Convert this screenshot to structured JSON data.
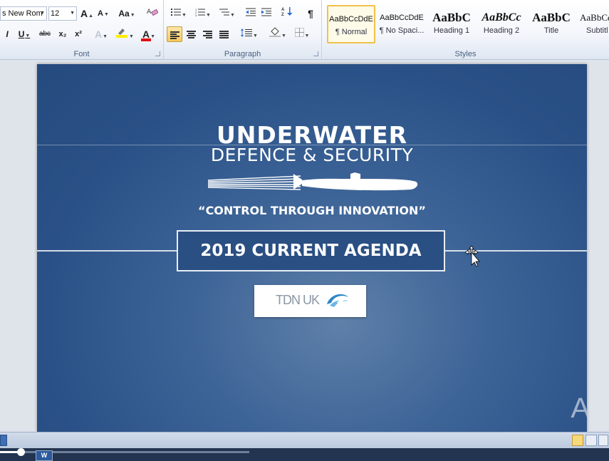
{
  "ribbon": {
    "font_group": {
      "label": "Font",
      "font_name": "s New Rom",
      "font_size": "12",
      "grow_font": "A",
      "shrink_font": "A",
      "change_case": "Aa",
      "italic": "I",
      "underline": "U",
      "strikethrough": "abc",
      "subscript": "x₂",
      "superscript": "x²",
      "font_color_glyph": "A"
    },
    "paragraph_group": {
      "label": "Paragraph",
      "pilcrow": "¶"
    },
    "styles_group": {
      "label": "Styles",
      "items": [
        {
          "sample": "AaBbCcDdE",
          "name": "¶ Normal"
        },
        {
          "sample": "AaBbCcDdE",
          "name": "¶ No Spaci..."
        },
        {
          "sample": "AaBbC",
          "name": "Heading 1"
        },
        {
          "sample": "AaBbCc",
          "name": "Heading 2"
        },
        {
          "sample": "AaBbC",
          "name": "Title"
        },
        {
          "sample": "AaBbCc",
          "name": "Subtitl"
        }
      ]
    }
  },
  "document": {
    "title_line1": "UNDERWATER",
    "title_line2": "DEFENCE & SECURITY",
    "tagline": "“CONTROL THROUGH INNOVATION”",
    "agenda": "2019 CURRENT AGENDA",
    "logo_text": "TDN UK",
    "watermark_letter": "A"
  },
  "player": {
    "app_icon": "W"
  },
  "colors": {
    "slide_blue": "#2a5187",
    "ribbon_highlight": "#f8c95a"
  }
}
